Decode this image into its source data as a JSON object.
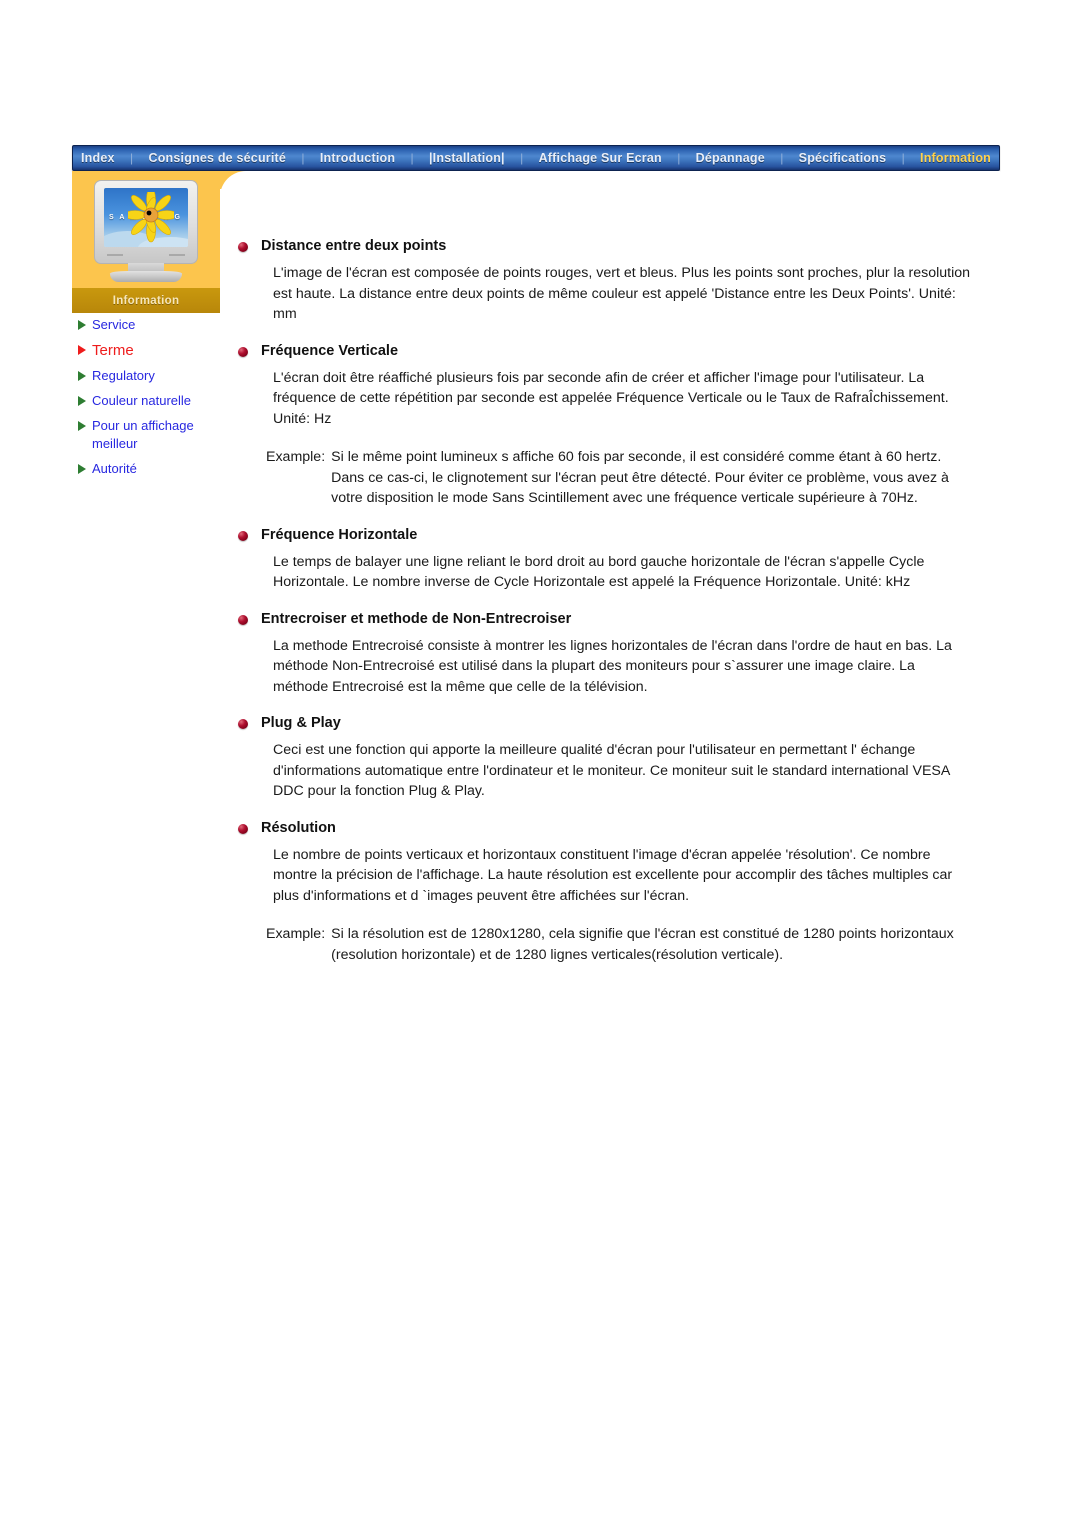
{
  "nav": {
    "items": [
      {
        "label": "Index",
        "active": false
      },
      {
        "label": "Consignes de sécurité",
        "active": false
      },
      {
        "label": "Introduction",
        "active": false
      },
      {
        "label": "|Installation|",
        "active": false
      },
      {
        "label": "Affichage Sur Ecran",
        "active": false
      },
      {
        "label": "Dépannage",
        "active": false
      },
      {
        "label": "Spécifications",
        "active": false
      },
      {
        "label": "Information",
        "active": true
      }
    ],
    "separator": "|"
  },
  "sidebar": {
    "tab_label": "Information",
    "thumbnail": {
      "brand_text": "S A M S U N G",
      "icon": "crt-monitor-icon"
    },
    "items": [
      {
        "label": "Service",
        "current": false
      },
      {
        "label": "Terme",
        "current": true
      },
      {
        "label": "Regulatory",
        "current": false
      },
      {
        "label": "Couleur naturelle",
        "current": false
      },
      {
        "label": "Pour un affichage meilleur",
        "current": false
      },
      {
        "label": "Autorité",
        "current": false
      }
    ]
  },
  "main": {
    "sections": [
      {
        "heading": "Distance entre deux points",
        "paragraph": "L'image de l'écran est composée de points rouges, vert et bleus. Plus les points sont proches, plur la resolution est haute. La distance entre deux points de même couleur est appelé 'Distance entre les Deux Points'. Unité: mm",
        "example_label": "",
        "example": ""
      },
      {
        "heading": "Fréquence Verticale",
        "paragraph": "L'écran doit être réaffiché plusieurs fois par seconde afin de créer et afficher l'image pour l'utilisateur. La fréquence de cette répétition par seconde est appelée Fréquence Verticale ou le Taux de RafraÎchissement. Unité: Hz",
        "example_label": "Example:",
        "example": "Si le même point lumineux s affiche 60 fois par seconde, il est considéré comme étant à 60 hertz. Dans ce cas-ci, le clignotement sur l'écran peut être détecté. Pour éviter ce problème, vous avez à votre disposition le mode Sans Scintillement avec une fréquence verticale supérieure à 70Hz."
      },
      {
        "heading": "Fréquence Horizontale",
        "paragraph": "Le temps de balayer une ligne reliant le bord droit au bord gauche horizontale de l'écran s'appelle Cycle Horizontale. Le nombre inverse de Cycle Horizontale est appelé la Fréquence Horizontale. Unité: kHz",
        "example_label": "",
        "example": ""
      },
      {
        "heading": "Entrecroiser et methode de Non-Entrecroiser",
        "paragraph": "La methode Entrecroisé consiste à montrer les lignes horizontales de l'écran dans l'ordre de haut en bas. La méthode Non-Entrecroisé est utilisé dans la plupart des moniteurs pour s`assurer une image claire. La méthode Entrecroisé est la même que celle de la télévision.",
        "example_label": "",
        "example": ""
      },
      {
        "heading": "Plug & Play",
        "paragraph": "Ceci est une fonction qui apporte la meilleure qualité d'écran pour l'utilisateur en permettant l' échange d'informations automatique entre l'ordinateur et le moniteur. Ce moniteur suit le standard international VESA DDC pour la fonction Plug & Play.",
        "example_label": "",
        "example": ""
      },
      {
        "heading": "Résolution",
        "paragraph": "Le nombre de points verticaux et horizontaux constituent l'image d'écran appelée 'résolution'. Ce nombre montre la précision de l'affichage. La haute résolution est excellente pour accomplir des tâches multiples car plus d'informations et d `images peuvent être affichées sur l'écran.",
        "example_label": "Example:",
        "example": "Si la résolution est de 1280x1280, cela signifie que l'écran est constitué de 1280 points horizontaux (resolution horizontale) et de 1280 lignes verticales(résolution verticale)."
      }
    ]
  },
  "colors": {
    "nav_start": "#1b3f84",
    "nav_end": "#17326c",
    "nav_active_text": "#ffd24d",
    "orange_band": "#fcc54d",
    "gold_tab": "#c9980e",
    "link_blue": "#2828e0",
    "current_red": "#ee1c1c",
    "arrow_green": "#2e7d32",
    "bullet_maroon": "#b01030"
  }
}
